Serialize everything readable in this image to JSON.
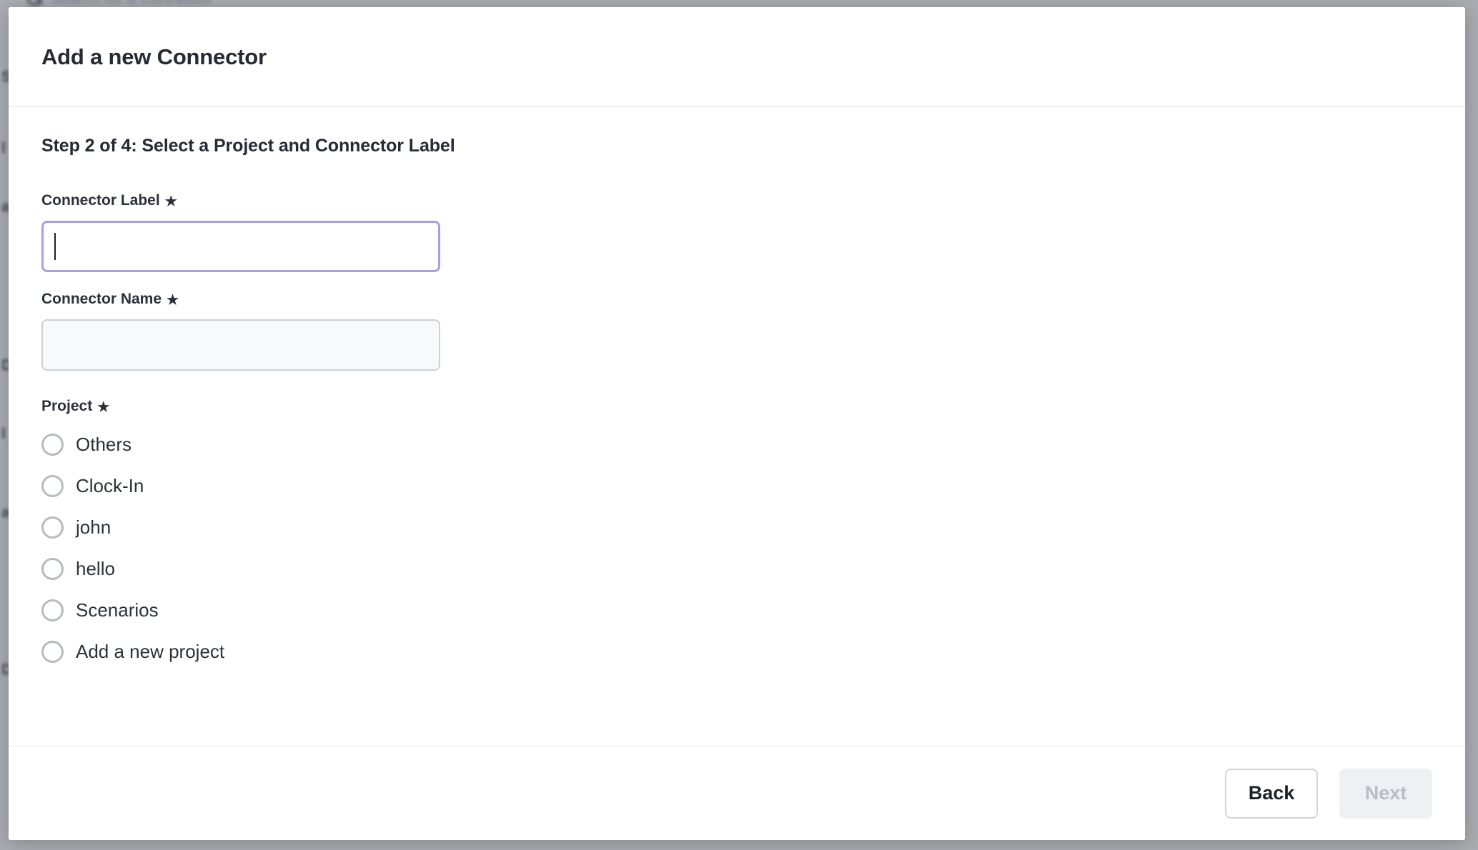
{
  "background": {
    "search_placeholder": "Search for a Connector",
    "search_icon": "search-icon",
    "side_fragments": [
      "S",
      "l",
      "a",
      "D",
      "l",
      "a",
      "D"
    ]
  },
  "modal": {
    "title": "Add a new Connector",
    "step_heading": "Step 2 of 4: Select a Project and Connector Label",
    "required_marker": "★",
    "fields": [
      {
        "label": "Connector Label",
        "required": true,
        "value": "",
        "placeholder": "",
        "state": "focused"
      },
      {
        "label": "Connector Name",
        "required": true,
        "value": "",
        "placeholder": "",
        "state": "muted"
      }
    ],
    "project": {
      "label": "Project",
      "required": true,
      "selected": null,
      "options": [
        {
          "label": "Others",
          "selected": false
        },
        {
          "label": "Clock-In",
          "selected": false
        },
        {
          "label": "john",
          "selected": false
        },
        {
          "label": "hello",
          "selected": false
        },
        {
          "label": "Scenarios",
          "selected": false
        },
        {
          "label": "Add a new project",
          "selected": false
        }
      ]
    },
    "footer": {
      "back_label": "Back",
      "next_label": "Next",
      "next_disabled": true
    }
  },
  "colors": {
    "focus_border": "#a79fe3",
    "title_text": "#252a33",
    "muted_field_bg": "#f8f9fb",
    "radio_border": "#b7babf",
    "disabled_btn_bg": "#eef0f3",
    "disabled_btn_text": "#b9bec5",
    "overlay": "#a9acb0"
  }
}
